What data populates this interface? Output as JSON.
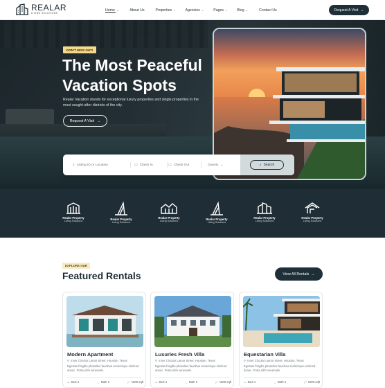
{
  "header": {
    "logo_name": "REALAR",
    "logo_sub": "LIVING SOLUTIONS",
    "nav": [
      {
        "label": "Home",
        "dropdown": true,
        "active": true
      },
      {
        "label": "About Us",
        "dropdown": false
      },
      {
        "label": "Properties",
        "dropdown": true
      },
      {
        "label": "Agencies",
        "dropdown": true
      },
      {
        "label": "Pages",
        "dropdown": true
      },
      {
        "label": "Blog",
        "dropdown": true
      },
      {
        "label": "Contact Us",
        "dropdown": false
      }
    ],
    "cta": "Request A Visit"
  },
  "hero": {
    "badge": "DON'T MISS OUT!",
    "title": "The Most Peaceful Vacation Spots",
    "description": "Realar Vacation stands for exceptional luxury properties and single properties in the most sought-after districts of the city.",
    "button": "Request A Visit"
  },
  "search": {
    "listing": "Listing ID or Location",
    "check_in": "Check In",
    "check_out": "Check Out",
    "guests": "Guests",
    "button": "Search"
  },
  "partners": [
    {
      "name": "Realar Property",
      "sub": "Living Solutions"
    },
    {
      "name": "Realar Property",
      "sub": "Living Solutions"
    },
    {
      "name": "Realar Property",
      "sub": "Living Solutions"
    },
    {
      "name": "Realar Property",
      "sub": "Living Solutions"
    },
    {
      "name": "Realar Property",
      "sub": "Living Solutions"
    },
    {
      "name": "Realar Property",
      "sub": "Living Solutions"
    }
  ],
  "featured": {
    "badge": "EXPLORE OUR",
    "title": "Featured Rentals",
    "view_all": "View All Rentals"
  },
  "rentals": [
    {
      "name": "Modern Apartment",
      "address": "Inner Circular Lamar Street, Houston, Texas",
      "description": "Egestas fringilla phasellus faucibus scelerisque eleifend donec. Porta nibh venenatis.",
      "bed": "Bed 4",
      "bath": "Bath 2",
      "area": "1500 sqft"
    },
    {
      "name": "Luxuries Fresh Villa",
      "address": "Inner Circular Lamar Street, Houston, Texas",
      "description": "Egestas fringilla phasellus faucibus scelerisque eleifend donec. Porta nibh venenatis.",
      "bed": "Bed 4",
      "bath": "Bath 2",
      "area": "1500 sqft"
    },
    {
      "name": "Equestarian Villa",
      "address": "Inner Circular Lamar Street, Houston, Texas",
      "description": "Egestas fringilla phasellus faucibus scelerisque eleifend donec. Porta nibh venenatis.",
      "bed": "Bed 4",
      "bath": "Bath 2",
      "area": "1500 sqft"
    }
  ],
  "colors": {
    "dark": "#1f2f38",
    "badge_yellow": "#f3d98b",
    "partners_bg": "#1f2e36"
  },
  "icons": {
    "logo": "building-icon",
    "location": "location-pin-icon",
    "calendar": "calendar-icon",
    "search": "search-icon",
    "arrow": "arrow-right-icon",
    "bed": "bed-icon",
    "bath": "bath-icon",
    "area": "area-icon"
  }
}
